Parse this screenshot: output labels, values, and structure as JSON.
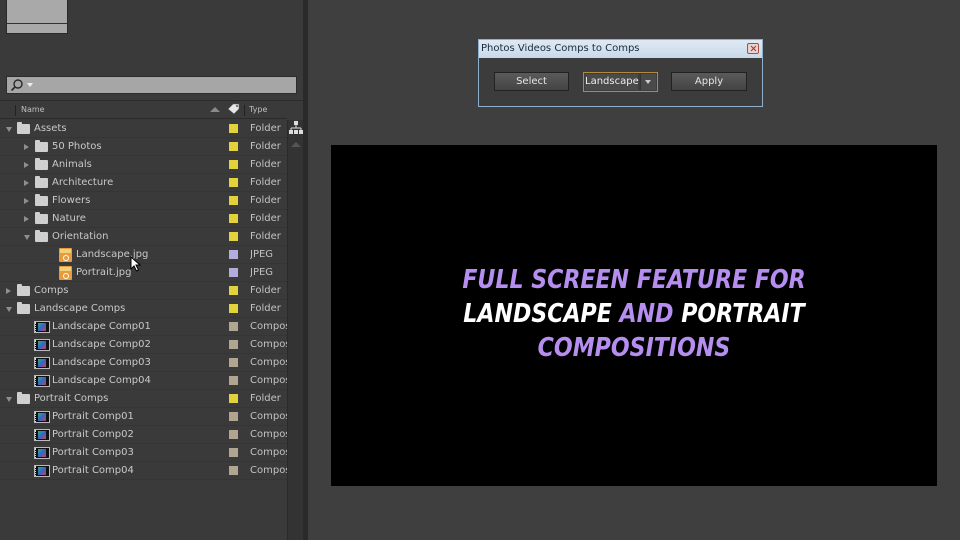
{
  "project": {
    "search": {
      "value": "",
      "placeholder": ""
    },
    "columns": {
      "name": "Name",
      "type": "Type"
    },
    "items": [
      {
        "name": "Assets",
        "kind": "folder",
        "depth": 0,
        "expanded": true,
        "twirl": "open",
        "label_color": "#e2d23c",
        "type": "Folder"
      },
      {
        "name": "50 Photos",
        "kind": "folder",
        "depth": 1,
        "expanded": false,
        "twirl": "closed",
        "label_color": "#e2d23c",
        "type": "Folder"
      },
      {
        "name": "Animals",
        "kind": "folder",
        "depth": 1,
        "expanded": false,
        "twirl": "closed",
        "label_color": "#e2d23c",
        "type": "Folder"
      },
      {
        "name": "Architecture",
        "kind": "folder",
        "depth": 1,
        "expanded": false,
        "twirl": "closed",
        "label_color": "#e2d23c",
        "type": "Folder"
      },
      {
        "name": "Flowers",
        "kind": "folder",
        "depth": 1,
        "expanded": false,
        "twirl": "closed",
        "label_color": "#e2d23c",
        "type": "Folder"
      },
      {
        "name": "Nature",
        "kind": "folder",
        "depth": 1,
        "expanded": false,
        "twirl": "closed",
        "label_color": "#e2d23c",
        "type": "Folder"
      },
      {
        "name": "Orientation",
        "kind": "folder",
        "depth": 1,
        "expanded": true,
        "twirl": "open",
        "label_color": "#e2d23c",
        "type": "Folder"
      },
      {
        "name": "Landscape.jpg",
        "kind": "jpeg",
        "depth": 2,
        "twirl": "none",
        "label_color": "#b3addb",
        "type": "JPEG"
      },
      {
        "name": "Portrait.jpg",
        "kind": "jpeg",
        "depth": 2,
        "twirl": "none",
        "label_color": "#b3addb",
        "type": "JPEG"
      },
      {
        "name": "Comps",
        "kind": "folder",
        "depth": 0,
        "expanded": false,
        "twirl": "closed",
        "label_color": "#e2d23c",
        "type": "Folder"
      },
      {
        "name": "Landscape Comps",
        "kind": "folder",
        "depth": 0,
        "expanded": true,
        "twirl": "open",
        "label_color": "#e2d23c",
        "type": "Folder"
      },
      {
        "name": "Landscape Comp01",
        "kind": "comp",
        "depth": 1,
        "twirl": "none",
        "label_color": "#b1a58f",
        "type": "Composition"
      },
      {
        "name": "Landscape Comp02",
        "kind": "comp",
        "depth": 1,
        "twirl": "none",
        "label_color": "#b1a58f",
        "type": "Composition"
      },
      {
        "name": "Landscape Comp03",
        "kind": "comp",
        "depth": 1,
        "twirl": "none",
        "label_color": "#b1a58f",
        "type": "Composition"
      },
      {
        "name": "Landscape Comp04",
        "kind": "comp",
        "depth": 1,
        "twirl": "none",
        "label_color": "#b1a58f",
        "type": "Composition"
      },
      {
        "name": "Portrait Comps",
        "kind": "folder",
        "depth": 0,
        "expanded": true,
        "twirl": "open",
        "label_color": "#e2d23c",
        "type": "Folder"
      },
      {
        "name": "Portrait Comp01",
        "kind": "comp",
        "depth": 1,
        "twirl": "none",
        "label_color": "#b1a58f",
        "type": "Composition"
      },
      {
        "name": "Portrait Comp02",
        "kind": "comp",
        "depth": 1,
        "twirl": "none",
        "label_color": "#b1a58f",
        "type": "Composition"
      },
      {
        "name": "Portrait Comp03",
        "kind": "comp",
        "depth": 1,
        "twirl": "none",
        "label_color": "#b1a58f",
        "type": "Composition"
      },
      {
        "name": "Portrait Comp04",
        "kind": "comp",
        "depth": 1,
        "twirl": "none",
        "label_color": "#b1a58f",
        "type": "Composition"
      }
    ]
  },
  "dialog": {
    "title": "Photos Videos Comps to Comps",
    "select_label": "Select",
    "dropdown_value": "Landscape",
    "apply_label": "Apply"
  },
  "composition": {
    "lines": [
      [
        {
          "text": "FULL SCREEN FEATURE FOR",
          "color": "purple"
        }
      ],
      [
        {
          "text": "LANDSCAPE ",
          "color": "white"
        },
        {
          "text": "AND",
          "color": "purple"
        },
        {
          "text": " PORTRAIT",
          "color": "white"
        }
      ],
      [
        {
          "text": "COMPOSITIONS",
          "color": "purple"
        }
      ]
    ],
    "colors": {
      "purple": "#b58ef0",
      "white": "#ffffff",
      "background": "#000000"
    }
  }
}
